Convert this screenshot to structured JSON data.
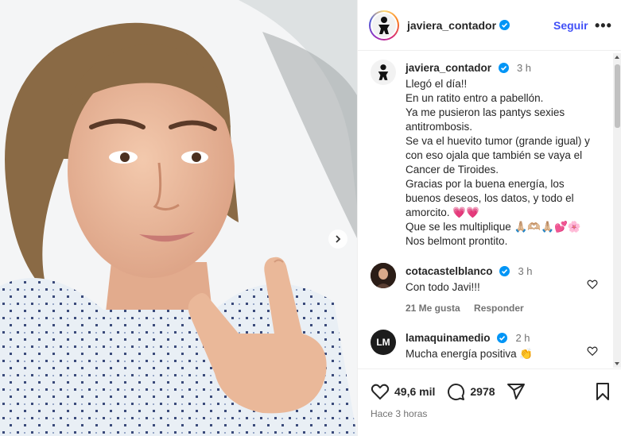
{
  "post": {
    "author": "javiera_contador",
    "follow_label": "Seguir",
    "more_label": "•••",
    "photo_alt": "selfie"
  },
  "caption": {
    "user": "javiera_contador",
    "time": "3 h",
    "text": "Llegó el día!!\nEn un ratito entro a pabellón.\nYa me pusieron las pantys sexies antitrombosis.\nSe va el huevito tumor (grande igual) y con eso ojala que también se vaya el Cancer de Tiroides.\nGracias por la buena energía, los buenos deseos, los datos, y todo el amorcito. 💗💗\nQue se les multiplique 🙏🏼🫶🏼🙏🏼💕🌸\nNos belmont prontito."
  },
  "comments": [
    {
      "user": "cotacastelblanco",
      "time": "3 h",
      "text": "Con todo Javi!!!",
      "likes": "21 Me gusta",
      "reply_label": "Responder"
    },
    {
      "user": "lamaquinamedio",
      "time": "2 h",
      "text": "Mucha energía positiva 👏",
      "avatar_text": "LM"
    }
  ],
  "stats": {
    "likes": "49,6 mil",
    "comments": "2978",
    "date": "Hace 3 horas"
  },
  "icons": {
    "heart": "heart-icon",
    "comment": "comment-icon",
    "share": "share-icon",
    "save": "bookmark-icon",
    "verified": "verified-badge-icon",
    "next": "chevron-right-icon"
  },
  "colors": {
    "follow": "#4150f7",
    "verified": "#0095f6",
    "hearts": "#e0245e"
  }
}
